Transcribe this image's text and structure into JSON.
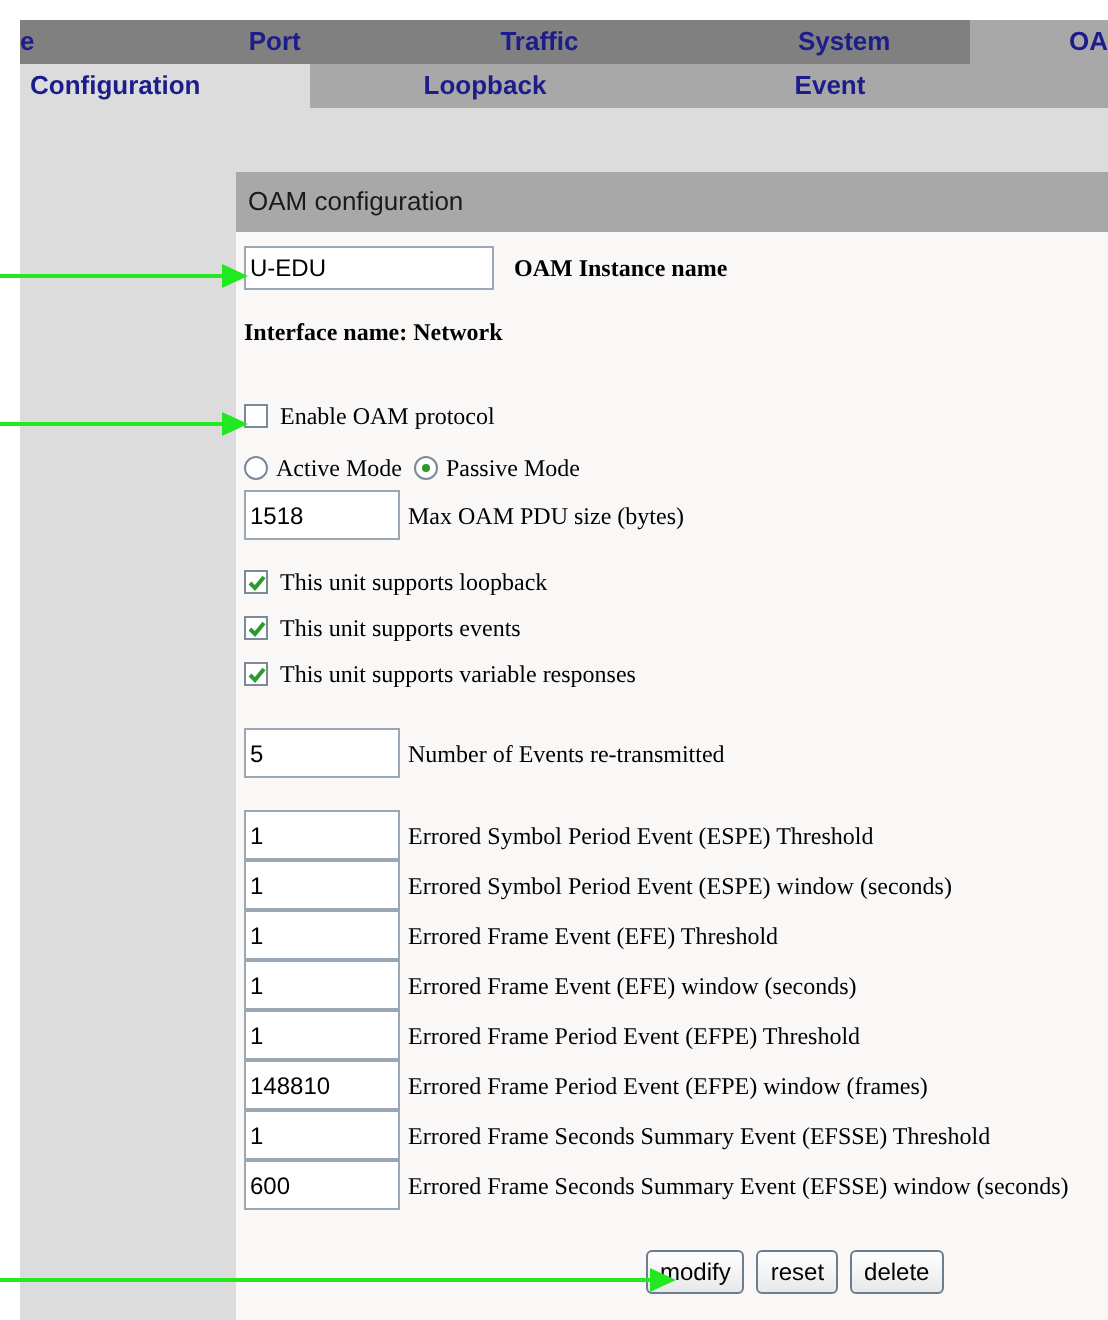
{
  "top_tabs": [
    {
      "label": "e",
      "selected": false
    },
    {
      "label": "Port",
      "selected": false
    },
    {
      "label": "Traffic",
      "selected": false
    },
    {
      "label": "System",
      "selected": false
    },
    {
      "label": "OA",
      "selected": true
    }
  ],
  "sub_tabs": [
    {
      "label": "Configuration",
      "selected": true
    },
    {
      "label": "Loopback",
      "selected": false
    },
    {
      "label": "Event",
      "selected": false
    }
  ],
  "panel": {
    "title": "OAM configuration",
    "instance": {
      "value": "U-EDU",
      "label": "OAM Instance name"
    },
    "interface_label": "Interface name: Network",
    "enable": {
      "label": "Enable OAM protocol",
      "checked": false
    },
    "modes": [
      {
        "label": "Active Mode",
        "selected": false
      },
      {
        "label": "Passive Mode",
        "selected": true
      }
    ],
    "max_pdu": {
      "value": "1518",
      "label": "Max OAM PDU size (bytes)"
    },
    "supports": [
      {
        "label": "This unit supports loopback",
        "checked": true
      },
      {
        "label": "This unit supports events",
        "checked": true
      },
      {
        "label": "This unit supports variable responses",
        "checked": true
      }
    ],
    "events_retransmit": {
      "value": "5",
      "label": "Number of Events re-transmitted"
    },
    "thresholds": [
      {
        "value": "1",
        "label": "Errored Symbol Period Event (ESPE) Threshold"
      },
      {
        "value": "1",
        "label": "Errored Symbol Period Event (ESPE) window (seconds)"
      },
      {
        "value": "1",
        "label": "Errored Frame Event (EFE) Threshold"
      },
      {
        "value": "1",
        "label": "Errored Frame Event (EFE) window (seconds)"
      },
      {
        "value": "1",
        "label": "Errored Frame Period Event (EFPE) Threshold"
      },
      {
        "value": "148810",
        "label": "Errored Frame Period Event (EFPE) window (frames)"
      },
      {
        "value": "1",
        "label": "Errored Frame Seconds Summary Event (EFSSE) Threshold"
      },
      {
        "value": "600",
        "label": "Errored Frame Seconds Summary Event (EFSSE) window (seconds)"
      }
    ],
    "buttons": [
      "modify",
      "reset",
      "delete"
    ]
  }
}
